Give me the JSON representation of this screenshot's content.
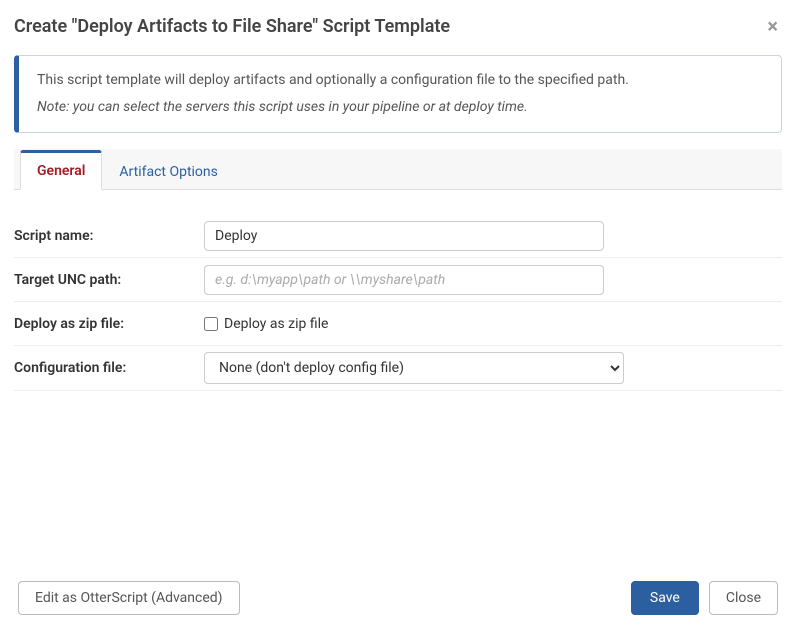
{
  "dialog": {
    "title": "Create \"Deploy Artifacts to File Share\" Script Template",
    "close_symbol": "×"
  },
  "info": {
    "text": "This script template will deploy artifacts and optionally a configuration file to the specified path.",
    "note": "Note: you can select the servers this script uses in your pipeline or at deploy time."
  },
  "tabs": {
    "general": "General",
    "artifact_options": "Artifact Options"
  },
  "form": {
    "script_name": {
      "label": "Script name:",
      "value": "Deploy"
    },
    "target_unc_path": {
      "label": "Target UNC path:",
      "placeholder": "e.g. d:\\myapp\\path or \\\\myshare\\path",
      "value": ""
    },
    "deploy_as_zip": {
      "label": "Deploy as zip file:",
      "checkbox_label": "Deploy as zip file"
    },
    "config_file": {
      "label": "Configuration file:",
      "selected": "None (don't deploy config file)"
    }
  },
  "footer": {
    "edit_advanced": "Edit as OtterScript (Advanced)",
    "save": "Save",
    "close": "Close"
  }
}
